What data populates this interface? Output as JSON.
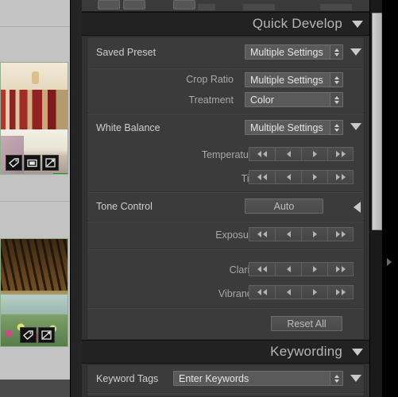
{
  "app": {
    "accent_green": "#3bbf3b",
    "panel_bg": "#3b3b3b",
    "header_bg": "#222222"
  },
  "grid": {
    "thumbnails": [
      {
        "name": "thumbnail-bedroom",
        "badges": [
          "keyword-tag-icon",
          "crop-icon",
          "develop-settings-icon"
        ],
        "color_label": "green"
      },
      {
        "name": "thumbnail-garden",
        "badges": [
          "keyword-tag-icon",
          "develop-settings-icon"
        ],
        "color_label": "green"
      }
    ]
  },
  "panels": [
    {
      "id": "quick-develop",
      "title": "Quick Develop",
      "disclosure": "triangle-down-icon",
      "rows": [
        {
          "id": "saved-preset",
          "label": "Saved Preset",
          "control": "combo",
          "value": "Multiple Settings",
          "disclosure": "triangle-down-icon"
        },
        {
          "id": "crop-ratio",
          "label": "Crop Ratio",
          "control": "combo",
          "value": "Multiple Settings"
        },
        {
          "id": "treatment",
          "label": "Treatment",
          "control": "combo",
          "value": "Color"
        },
        {
          "id": "white-balance",
          "label": "White Balance",
          "control": "combo",
          "value": "Multiple Settings",
          "disclosure": "triangle-down-icon"
        },
        {
          "id": "temperature",
          "label": "Temperature",
          "control": "nudge"
        },
        {
          "id": "tint",
          "label": "Tint",
          "control": "nudge"
        },
        {
          "id": "tone-control",
          "label": "Tone Control",
          "control": "button",
          "value": "Auto",
          "disclosure": "triangle-left-icon"
        },
        {
          "id": "exposure",
          "label": "Exposure",
          "control": "nudge"
        },
        {
          "id": "clarity",
          "label": "Clarity",
          "control": "nudge"
        },
        {
          "id": "vibrance",
          "label": "Vibrance",
          "control": "nudge"
        },
        {
          "id": "reset-all",
          "label": "",
          "control": "button",
          "value": "Reset All"
        }
      ]
    },
    {
      "id": "keywording",
      "title": "Keywording",
      "disclosure": "triangle-down-icon",
      "rows": [
        {
          "id": "keyword-tags",
          "label": "Keyword Tags",
          "control": "combo",
          "value": "Enter Keywords",
          "disclosure": "triangle-down-icon"
        }
      ]
    }
  ],
  "nudge_icons": {
    "big_left": "double-left-arrow-icon",
    "small_left": "left-arrow-icon",
    "small_right": "right-arrow-icon",
    "big_right": "double-right-arrow-icon"
  },
  "scrollbar": {
    "name": "vertical-scrollbar",
    "orientation": "vertical"
  },
  "edge": {
    "expand_arrow": "panel-expand-arrow-icon"
  }
}
